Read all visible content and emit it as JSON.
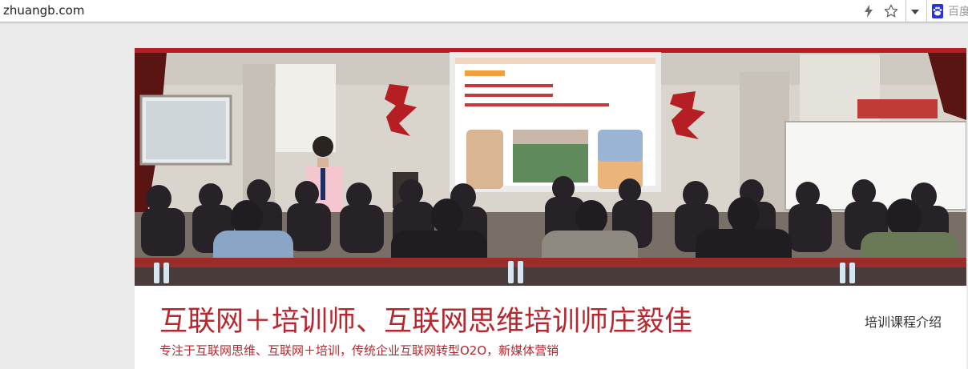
{
  "browser": {
    "url": "zhuangb.com",
    "search_placeholder": "百度"
  },
  "header": {
    "title": "互联网＋培训师、互联网思维培训师庄毅佳",
    "subtitle": "专注于互联网思维、互联网＋培训，传统企业互联网转型O2O，新媒体营销",
    "nav_link": "培训课程介绍"
  },
  "colors": {
    "title_red": "#b7272d",
    "page_background": "#ebebeb"
  },
  "icons": {
    "address_bar": [
      "lightning-icon",
      "star-icon",
      "chevron-down-icon",
      "baidu-logo-icon"
    ]
  }
}
